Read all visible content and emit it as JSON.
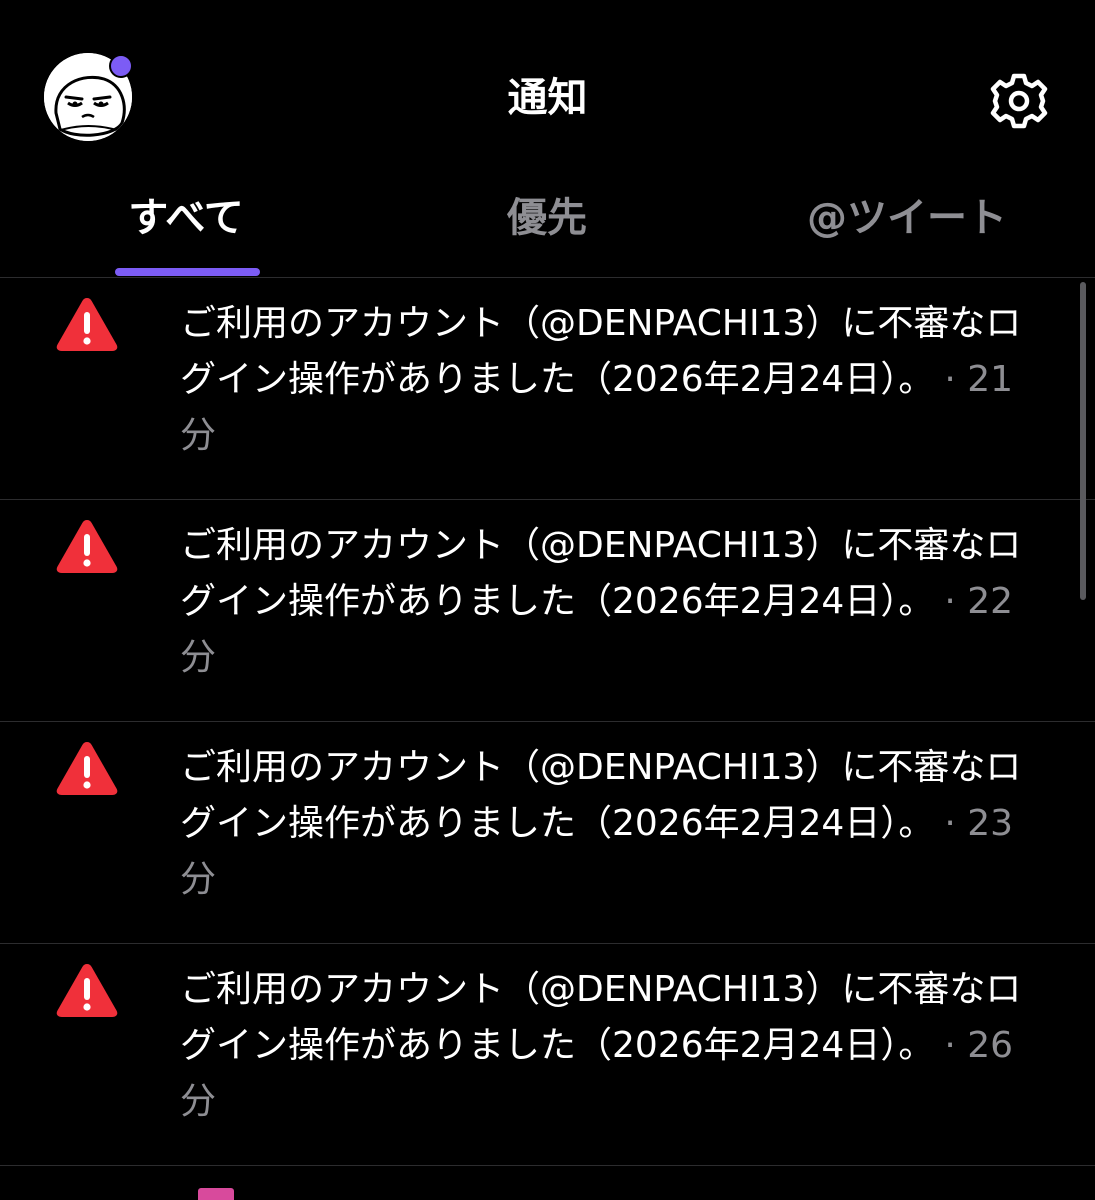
{
  "header": {
    "title": "通知",
    "avatar_icon": "avatar-icon",
    "settings_icon": "gear-icon",
    "accent_color": "#7c5cf5"
  },
  "tabs": [
    {
      "label": "すべて",
      "selected": true
    },
    {
      "label": "優先",
      "selected": false
    },
    {
      "label": "@ツイート",
      "selected": false
    }
  ],
  "notifications": [
    {
      "icon": "warning-icon",
      "message": "ご利用のアカウント（@DENPACHI13）に不審なログイン操作がありました（2026年2月24日）。",
      "time": "· 21分"
    },
    {
      "icon": "warning-icon",
      "message": "ご利用のアカウント（@DENPACHI13）に不審なログイン操作がありました（2026年2月24日）。",
      "time": "· 22分"
    },
    {
      "icon": "warning-icon",
      "message": "ご利用のアカウント（@DENPACHI13）に不審なログイン操作がありました（2026年2月24日）。",
      "time": "· 23分"
    },
    {
      "icon": "warning-icon",
      "message": "ご利用のアカウント（@DENPACHI13）に不審なログイン操作がありました（2026年2月24日）。",
      "time": "· 26分"
    }
  ],
  "colors": {
    "background": "#000000",
    "warning": "#f0303a",
    "secondary_text": "#8e8e93",
    "divider": "#2c2c2e"
  }
}
